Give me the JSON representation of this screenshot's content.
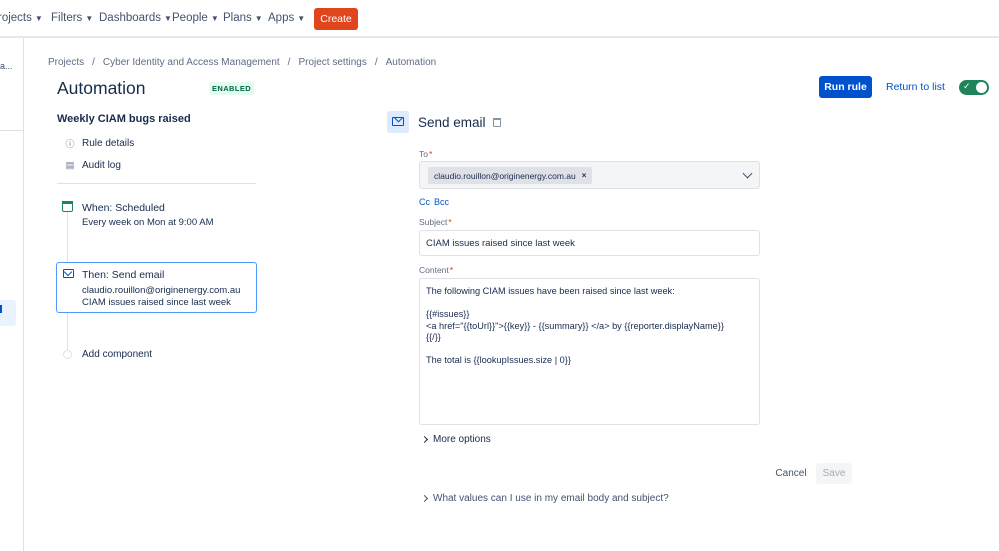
{
  "nav": {
    "items": [
      "rojects",
      "Filters",
      "Dashboards",
      "People",
      "Plans",
      "Apps"
    ],
    "create_label": "Create"
  },
  "sidebar": {
    "fragment": "a..."
  },
  "breadcrumb": [
    "Projects",
    "Cyber Identity and Access Management",
    "Project settings",
    "Automation"
  ],
  "header": {
    "title": "Automation",
    "status_badge": "ENABLED",
    "run_rule_label": "Run rule",
    "return_label": "Return to list",
    "enabled_toggle": true
  },
  "rule": {
    "name": "Weekly CIAM bugs raised",
    "links": [
      {
        "label": "Rule details",
        "icon": "info-icon"
      },
      {
        "label": "Audit log",
        "icon": "document-icon"
      }
    ],
    "trigger": {
      "title": "When: Scheduled",
      "subtitle": "Every week on Mon at 9:00 AM",
      "icon": "calendar-icon"
    },
    "action": {
      "title": "Then: Send email",
      "line1": "claudio.rouillon@originenergy.com.au",
      "line2": "CIAM issues raised since last week",
      "icon": "email-icon"
    },
    "add_component_label": "Add component"
  },
  "email": {
    "section_title": "Send email",
    "to_label": "To",
    "to_values": [
      "claudio.rouillon@originenergy.com.au"
    ],
    "cc_label": "Cc",
    "bcc_label": "Bcc",
    "subject_label": "Subject",
    "subject_value": "CIAM issues raised since last week",
    "content_label": "Content",
    "content_lines": [
      "The following CIAM issues have been raised since last week:",
      "",
      "{{#issues}}",
      "<a href=\"{{toUrl}}\">{{key}} - {{summary}} </a> by {{reporter.displayName}}",
      "{{/}}",
      "",
      "The total is {{lookupIssues.size | 0}}"
    ],
    "more_options_label": "More options",
    "cancel_label": "Cancel",
    "save_label": "Save",
    "help_label": "What values can I use in my email body and subject?"
  },
  "colors": {
    "create": "#e0451c",
    "primary": "#0052cc",
    "toggle_on": "#1f845a",
    "badge_bg": "#e3fcef",
    "badge_text": "#006644"
  }
}
